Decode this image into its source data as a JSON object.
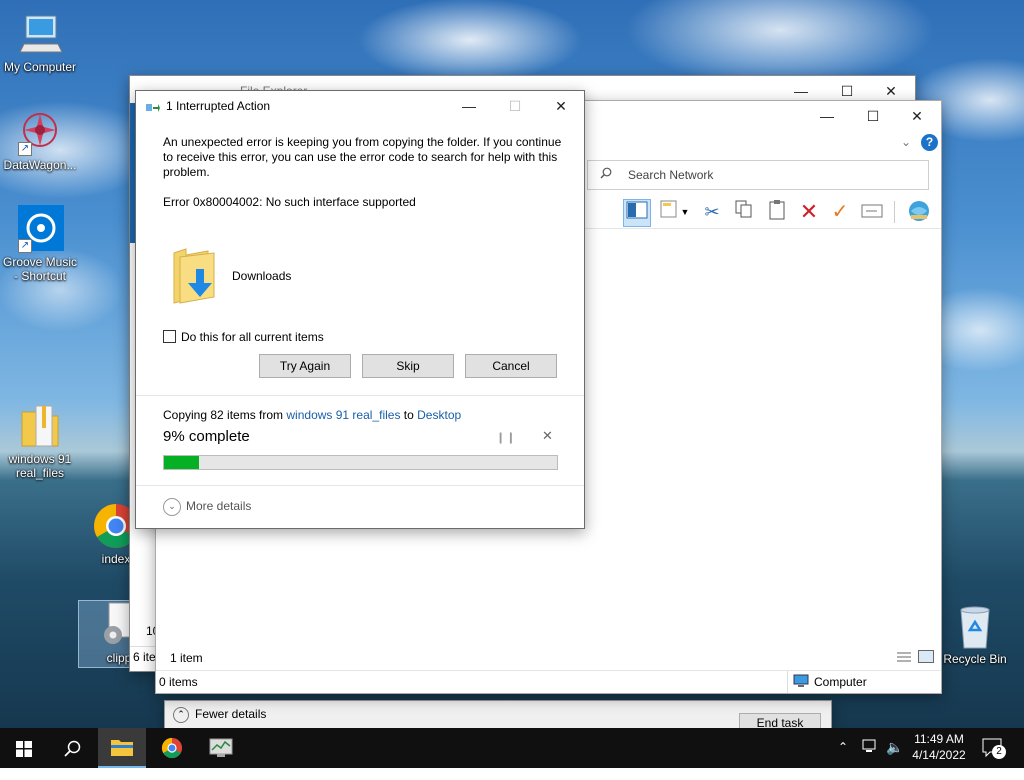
{
  "desktop": {
    "icons": [
      {
        "label": "My Computer"
      },
      {
        "label": "DataWagon..."
      },
      {
        "label": "Groove Music - Shortcut"
      },
      {
        "label": "windows 91 real_files"
      },
      {
        "label": "index"
      },
      {
        "label": "clipp"
      },
      {
        "label": "Recycle Bin"
      }
    ]
  },
  "task_manager": {
    "fewer_details": "Fewer details",
    "end_task": "End task"
  },
  "file_explorer_back": {
    "title": "File Explorer",
    "status_items": "6 ite",
    "count_fragment": "10"
  },
  "network_explorer": {
    "search_placeholder": "Search Network",
    "item_count": "1 item",
    "status_items": "0 items",
    "status_location": "Computer"
  },
  "dialog": {
    "title": "1 Interrupted Action",
    "message": "An unexpected error is keeping you from copying the folder. If you continue to receive this error, you can use the error code to search for help with this problem.",
    "error": "Error 0x80004002: No such interface supported",
    "folder_name": "Downloads",
    "checkbox_label": "Do this for all current items",
    "buttons": {
      "try_again": "Try Again",
      "skip": "Skip",
      "cancel": "Cancel"
    },
    "copy": {
      "prefix": "Copying 82 items from ",
      "source": "windows 91 real_files",
      "middle": " to ",
      "destination": "Desktop"
    },
    "percent_text": "9% complete",
    "progress_fraction": 0.09,
    "more_details": "More details"
  },
  "taskbar": {
    "time": "11:49 AM",
    "date": "4/14/2022",
    "notification_count": "2"
  },
  "colors": {
    "progress": "#06b025",
    "link": "#1a5fa8",
    "taskbar": "#101010"
  }
}
